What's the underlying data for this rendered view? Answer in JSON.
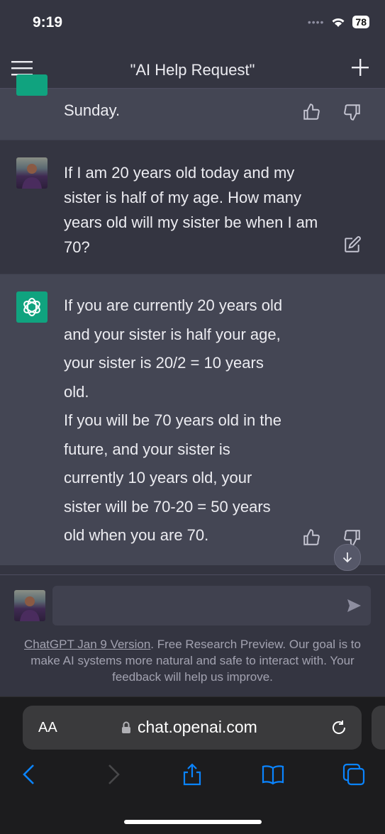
{
  "status": {
    "time": "9:19",
    "battery": "78"
  },
  "header": {
    "title": "\"AI Help Request\""
  },
  "messages": {
    "prev_assistant_tail": "Sunday.",
    "user": {
      "lines": [
        "If I am 20 years old today and my",
        "sister is half of my age. How many",
        "years old will my sister be when I am",
        "70?"
      ]
    },
    "assistant": {
      "lines": [
        "If you are currently 20 years old",
        "and your sister is half your age,",
        "your sister is 20/2 = 10 years",
        "old.",
        "If you will be 70 years old in the",
        "future, and your sister is",
        "currently 10 years old, your",
        "sister will be 70-20 = 50 years",
        "old when you are 70."
      ]
    }
  },
  "composer": {
    "placeholder": "",
    "footer_link": "ChatGPT Jan 9 Version",
    "footer_text_1": ". Free Research Preview. Our goal is to",
    "footer_text_2": "make AI systems more natural and safe to interact with. Your",
    "footer_text_3": "feedback will help us improve."
  },
  "browser": {
    "aa": "AA",
    "url": "chat.openai.com"
  },
  "colors": {
    "accent": "#10a37f",
    "ios_blue": "#0a84ff",
    "bg": "#343541",
    "assistant_bg": "#444654"
  },
  "icons": [
    "menu-icon",
    "plus-icon",
    "thumbs-up-icon",
    "thumbs-down-icon",
    "edit-icon",
    "openai-logo-icon",
    "arrow-down-icon",
    "send-icon",
    "lock-icon",
    "reload-icon",
    "back-icon",
    "forward-icon",
    "share-icon",
    "bookmarks-icon",
    "tabs-icon"
  ]
}
